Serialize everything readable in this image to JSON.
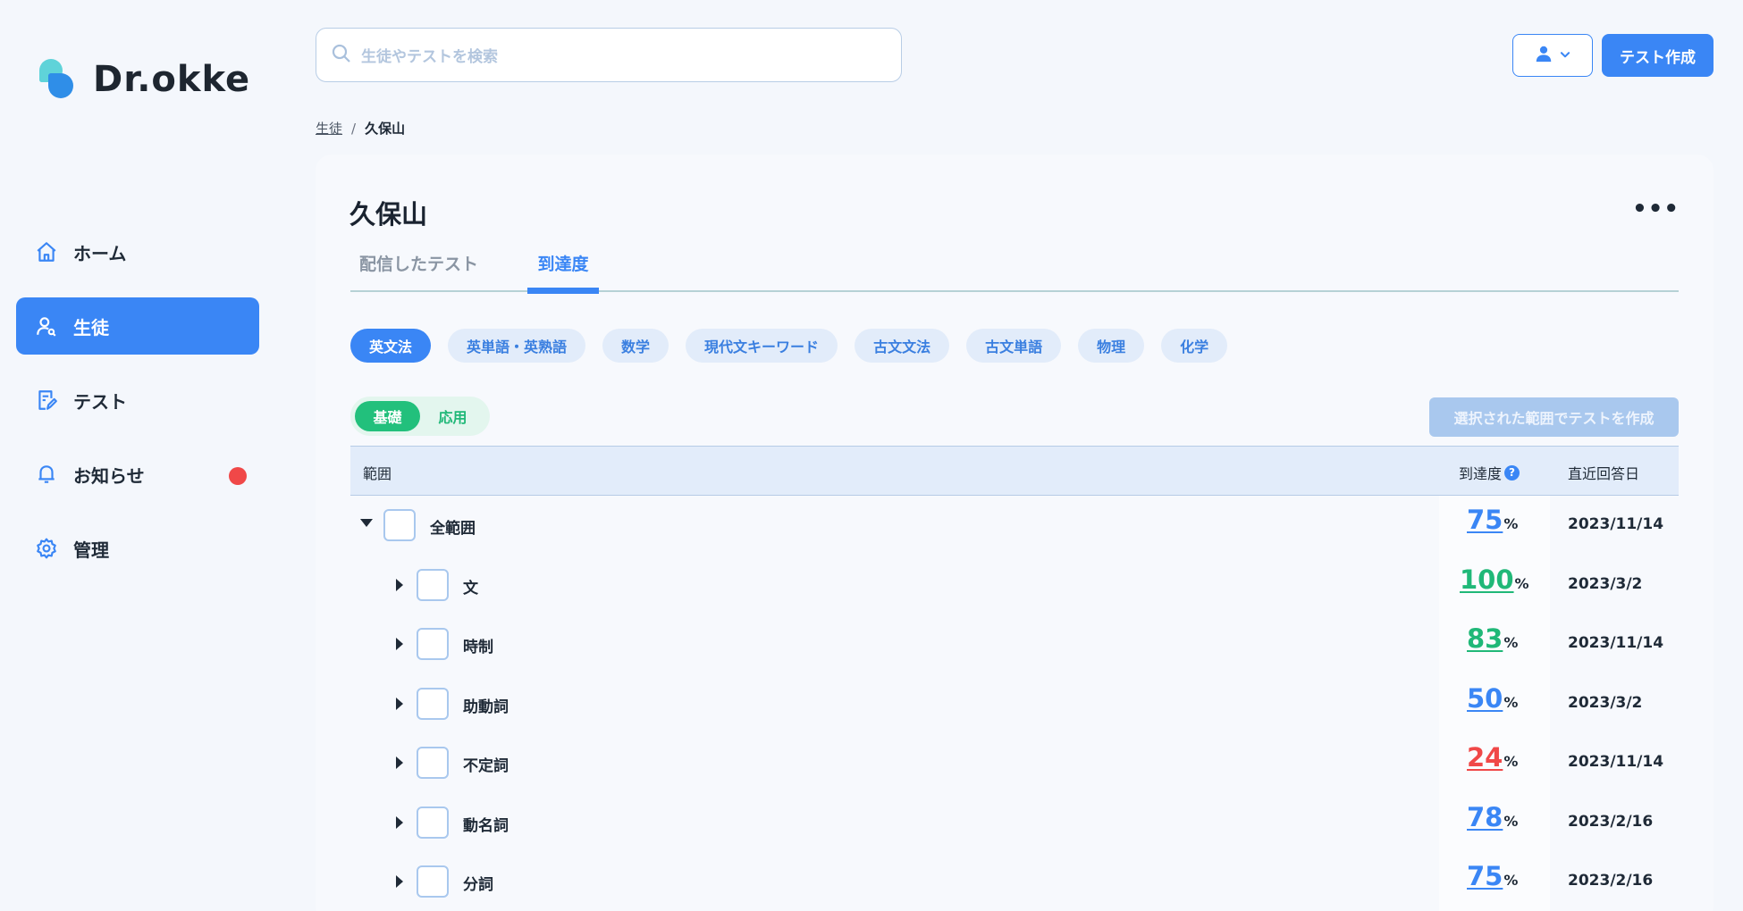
{
  "brand": {
    "name": "Dr.okke"
  },
  "nav": [
    {
      "label": "ホーム",
      "icon": "home-icon"
    },
    {
      "label": "生徒",
      "icon": "student-icon",
      "active": true
    },
    {
      "label": "テスト",
      "icon": "test-icon"
    },
    {
      "label": "お知らせ",
      "icon": "bell-icon",
      "badge": true
    },
    {
      "label": "管理",
      "icon": "gear-icon"
    }
  ],
  "header": {
    "search_placeholder": "生徒やテストを検索",
    "create_label": "テスト作成"
  },
  "breadcrumb": {
    "parent": "生徒",
    "separator": "/",
    "current": "久保山"
  },
  "page": {
    "title": "久保山",
    "more": "•••",
    "tabs": [
      {
        "label": "配信したテスト"
      },
      {
        "label": "到達度",
        "active": true
      }
    ]
  },
  "subjects": [
    "英文法",
    "英単語・英熟語",
    "数学",
    "現代文キーワード",
    "古文文法",
    "古文単語",
    "物理",
    "化学"
  ],
  "level_toggle": {
    "basic": "基礎",
    "applied": "応用"
  },
  "range_test_button": "選択された範囲でテストを作成",
  "table": {
    "headers": {
      "range": "範囲",
      "rate": "到達度",
      "rate_help": "?",
      "date": "直近回答日"
    },
    "rows": [
      {
        "label": "全範囲",
        "rate": "75",
        "pct": "%",
        "date": "2023/11/14",
        "level": 0,
        "expanded": true,
        "color": "#3a86f5"
      },
      {
        "label": "文",
        "rate": "100",
        "pct": "%",
        "date": "2023/3/2",
        "level": 1,
        "expanded": false,
        "color": "#20b878"
      },
      {
        "label": "時制",
        "rate": "83",
        "pct": "%",
        "date": "2023/11/14",
        "level": 1,
        "expanded": false,
        "color": "#20b878"
      },
      {
        "label": "助動詞",
        "rate": "50",
        "pct": "%",
        "date": "2023/3/2",
        "level": 1,
        "expanded": false,
        "color": "#3a86f5"
      },
      {
        "label": "不定詞",
        "rate": "24",
        "pct": "%",
        "date": "2023/11/14",
        "level": 1,
        "expanded": false,
        "color": "#f04848"
      },
      {
        "label": "動名詞",
        "rate": "78",
        "pct": "%",
        "date": "2023/2/16",
        "level": 1,
        "expanded": false,
        "color": "#3a86f5"
      },
      {
        "label": "分詞",
        "rate": "75",
        "pct": "%",
        "date": "2023/2/16",
        "level": 1,
        "expanded": false,
        "color": "#3a86f5"
      }
    ]
  }
}
